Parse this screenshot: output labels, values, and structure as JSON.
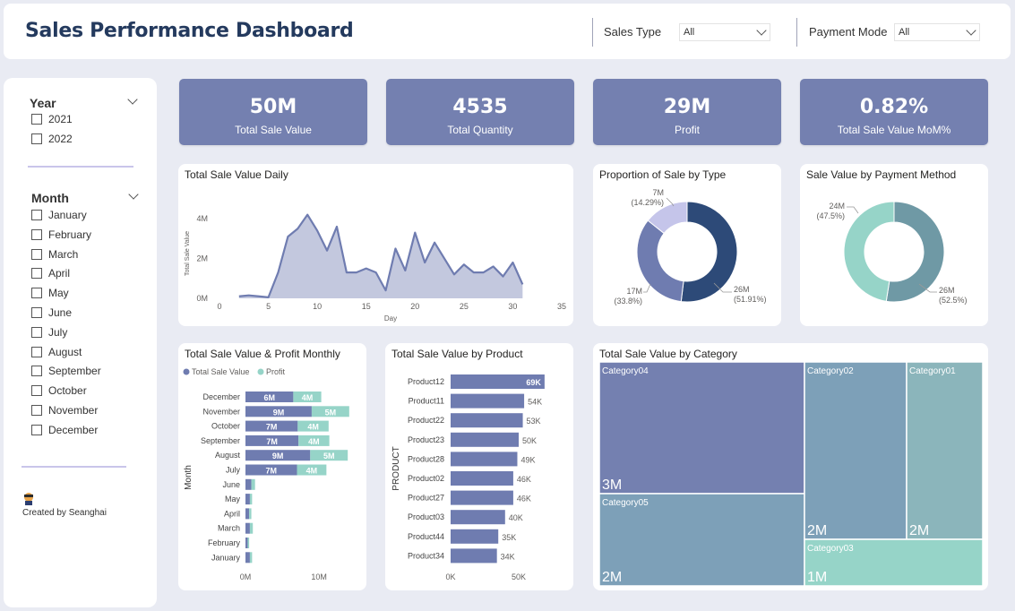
{
  "header": {
    "title": "Sales Performance Dashboard",
    "sales_type_label": "Sales Type",
    "sales_type_value": "All",
    "payment_mode_label": "Payment Mode",
    "payment_mode_value": "All"
  },
  "slicer": {
    "year_title": "Year",
    "years": [
      "2021",
      "2022"
    ],
    "month_title": "Month",
    "months": [
      "January",
      "February",
      "March",
      "April",
      "May",
      "June",
      "July",
      "August",
      "September",
      "October",
      "November",
      "December"
    ],
    "credit": "Created by Seanghai"
  },
  "kpis": [
    {
      "value": "50M",
      "label": "Total Sale Value"
    },
    {
      "value": "4535",
      "label": "Total Quantity"
    },
    {
      "value": "29M",
      "label": "Profit"
    },
    {
      "value": "0.82%",
      "label": "Total Sale Value MoM%"
    }
  ],
  "colors": {
    "kpi_bg": "#7480b0",
    "primary": "#6f7cb0",
    "teal": "#96d4c8",
    "navy": "#2d4a78",
    "lavender": "#c5c5ea",
    "steel": "#6f99a5",
    "treemap_a": "#7480b0",
    "treemap_b": "#7da0b8",
    "treemap_c": "#8bb5bb"
  },
  "chart_data": [
    {
      "type": "area",
      "title": "Total Sale Value Daily",
      "xlabel": "Day",
      "ylabel": "Total Sale Value",
      "xlim": [
        0,
        35
      ],
      "ylim": [
        0,
        4.5
      ],
      "x_ticks": [
        "0",
        "5",
        "10",
        "15",
        "20",
        "25",
        "30",
        "35"
      ],
      "y_ticks": [
        "0M",
        "2M",
        "4M"
      ],
      "x": [
        2,
        3,
        4,
        5,
        6,
        7,
        8,
        9,
        10,
        11,
        12,
        13,
        14,
        15,
        16,
        17,
        18,
        19,
        20,
        21,
        22,
        23,
        24,
        25,
        26,
        27,
        28,
        29,
        30,
        31
      ],
      "y": [
        0.1,
        0.15,
        0.1,
        0.05,
        1.3,
        3.1,
        3.5,
        4.2,
        3.4,
        2.4,
        3.6,
        1.3,
        1.3,
        1.5,
        1.3,
        0.4,
        2.5,
        1.4,
        3.3,
        1.8,
        2.8,
        2.0,
        1.2,
        1.7,
        1.3,
        1.3,
        1.6,
        1.1,
        1.8,
        0.7
      ],
      "unit": "M"
    },
    {
      "type": "pie",
      "title": "Proportion of Sale by Type",
      "slices": [
        {
          "label": "26M",
          "pct": "(51.91%)",
          "value": 51.91,
          "color": "#2d4a78"
        },
        {
          "label": "17M",
          "pct": "(33.8%)",
          "value": 33.8,
          "color": "#6f7cb0"
        },
        {
          "label": "7M",
          "pct": "(14.29%)",
          "value": 14.29,
          "color": "#c5c5ea"
        }
      ]
    },
    {
      "type": "pie",
      "title": "Sale Value by Payment Method",
      "slices": [
        {
          "label": "26M",
          "pct": "(52.5%)",
          "value": 52.5,
          "color": "#6f99a5"
        },
        {
          "label": "24M",
          "pct": "(47.5%)",
          "value": 47.5,
          "color": "#96d4c8"
        }
      ]
    },
    {
      "type": "bar",
      "title": "Total Sale Value & Profit Monthly",
      "ylabel": "Month",
      "legend": [
        "Total Sale Value",
        "Profit"
      ],
      "categories": [
        "December",
        "November",
        "October",
        "September",
        "August",
        "July",
        "June",
        "May",
        "April",
        "March",
        "February",
        "January"
      ],
      "series": [
        {
          "name": "Total Sale Value",
          "values": [
            6.5,
            9,
            7.1,
            7.2,
            8.8,
            7,
            0.8,
            0.6,
            0.5,
            0.6,
            0.3,
            0.6
          ],
          "labels": [
            "6M",
            "9M",
            "7M",
            "7M",
            "9M",
            "7M",
            "",
            "",
            "",
            "",
            "",
            ""
          ]
        },
        {
          "name": "Profit",
          "values": [
            3.8,
            5.1,
            4.2,
            4.2,
            5.1,
            4.0,
            0.5,
            0.3,
            0.3,
            0.4,
            0.2,
            0.3
          ],
          "labels": [
            "4M",
            "5M",
            "4M",
            "4M",
            "5M",
            "4M",
            "",
            "",
            "",
            "",
            "",
            ""
          ]
        }
      ],
      "x_ticks": [
        "0M",
        "10M"
      ],
      "xlim": [
        0,
        14
      ]
    },
    {
      "type": "bar",
      "title": "Total Sale Value by Product",
      "ylabel": "PRODUCT",
      "categories": [
        "Product12",
        "Product11",
        "Product22",
        "Product23",
        "Product28",
        "Product02",
        "Product27",
        "Product03",
        "Product44",
        "Product34"
      ],
      "values": [
        69,
        54,
        53,
        50,
        49,
        46,
        46,
        40,
        35,
        34
      ],
      "value_labels": [
        "69K",
        "54K",
        "53K",
        "50K",
        "49K",
        "46K",
        "46K",
        "40K",
        "35K",
        "34K"
      ],
      "x_ticks": [
        "0K",
        "50K"
      ],
      "xlim": [
        0,
        100
      ]
    },
    {
      "type": "heatmap",
      "title": "Total Sale Value by Category",
      "cells": [
        {
          "name": "Category04",
          "value": "3M"
        },
        {
          "name": "Category05",
          "value": "2M"
        },
        {
          "name": "Category02",
          "value": "2M"
        },
        {
          "name": "Category01",
          "value": "2M"
        },
        {
          "name": "Category03",
          "value": "1M"
        }
      ]
    }
  ]
}
